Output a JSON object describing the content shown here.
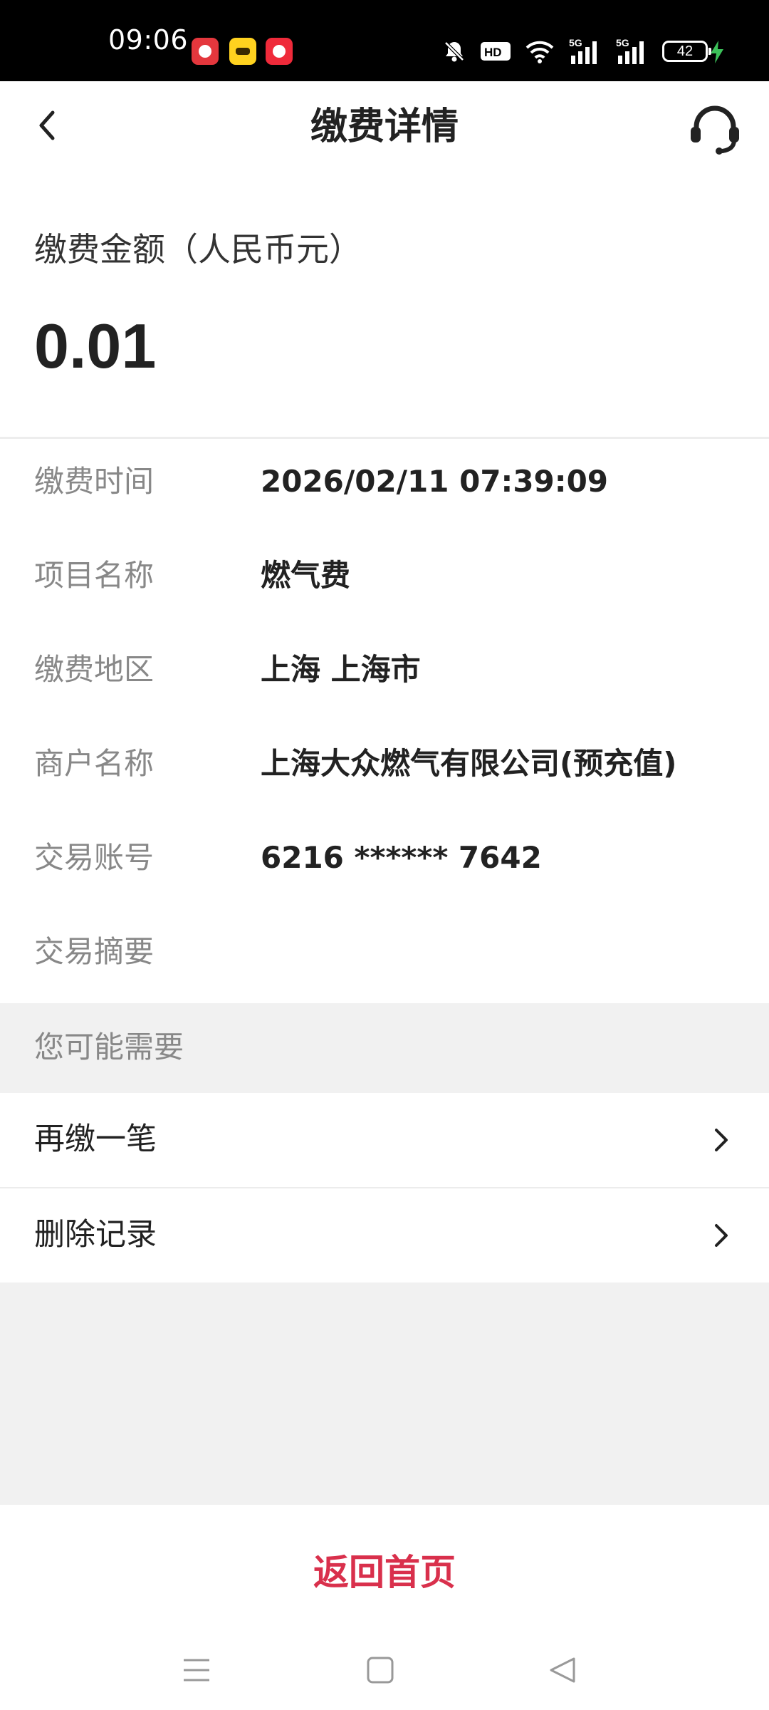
{
  "status_bar": {
    "time": "09:06",
    "battery": "42",
    "network_1": "5G",
    "network_2": "5G",
    "hd_badge": "HD",
    "icons": [
      "app-icon-1",
      "app-icon-2",
      "app-icon-3",
      "mute-icon",
      "hd-icon",
      "wifi-icon",
      "signal-icon",
      "signal-icon",
      "battery-icon",
      "charging-icon"
    ]
  },
  "header": {
    "title": "缴费详情",
    "back_icon": "chevron-left-icon",
    "service_icon": "headset-icon"
  },
  "amount": {
    "label": "缴费金额（人民币元）",
    "value": "0.01"
  },
  "details": [
    {
      "label": "缴费时间",
      "value": "2026/02/11 07:39:09"
    },
    {
      "label": "项目名称",
      "value": "燃气费"
    },
    {
      "label": "缴费地区",
      "value": "上海 上海市"
    },
    {
      "label": "商户名称",
      "value": "上海大众燃气有限公司(预充值)"
    },
    {
      "label": "交易账号",
      "value": "6216 ****** 7642"
    },
    {
      "label": "交易摘要",
      "value": ""
    }
  ],
  "suggestions": {
    "title": "您可能需要",
    "items": [
      {
        "label": "再缴一笔"
      },
      {
        "label": "删除记录"
      }
    ]
  },
  "footer": {
    "home_label": "返回首页"
  },
  "colors": {
    "accent": "#d9304c",
    "background": "#f1f1f1",
    "label_gray": "#888888",
    "text_dark": "#222222"
  }
}
